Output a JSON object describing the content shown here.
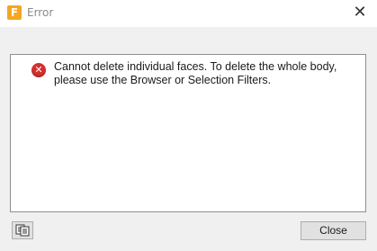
{
  "window": {
    "app_icon_letter": "F",
    "title": "Error",
    "close_glyph": "✕"
  },
  "message": {
    "icon_glyph": "✕",
    "text": "Cannot delete individual faces. To delete the whole body, please use the Browser or Selection Filters."
  },
  "footer": {
    "copy_icon": "copy-details-icon",
    "close_label": "Close"
  },
  "colors": {
    "app_accent": "#f5a623",
    "error_red": "#d32f2f",
    "dialog_bg": "#f0f0f0"
  }
}
